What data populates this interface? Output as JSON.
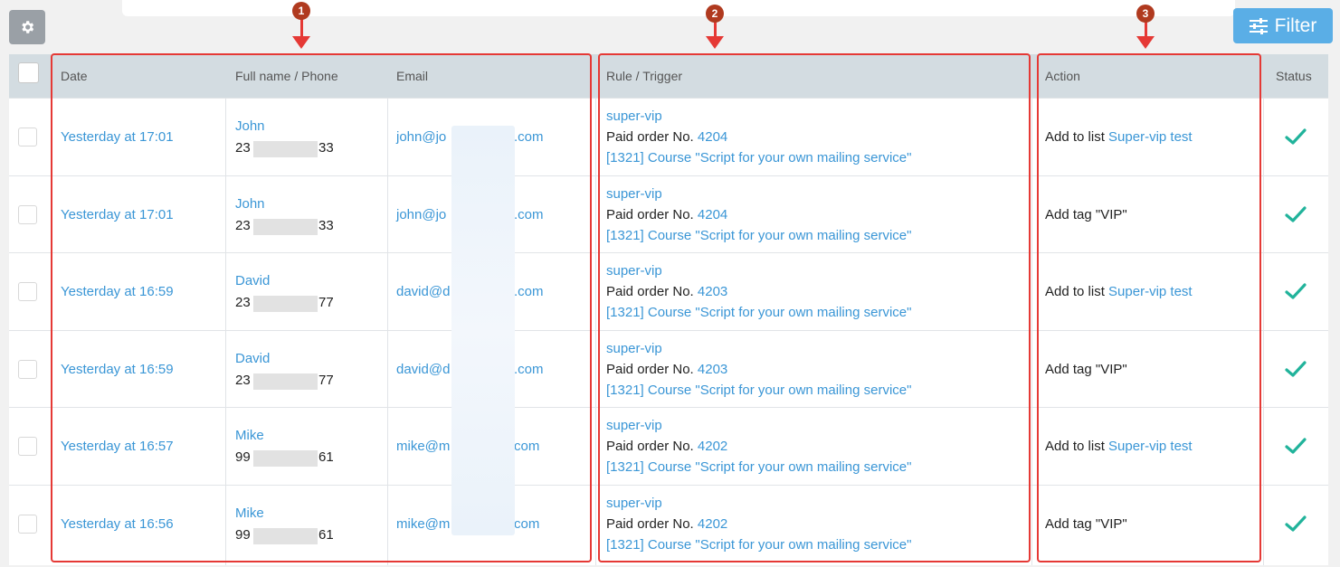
{
  "toolbar": {
    "filter_label": "Filter",
    "settings_icon": "gear-icon",
    "filter_icon": "sliders-icon"
  },
  "headers": {
    "date": "Date",
    "name_phone": "Full name / Phone",
    "email": "Email",
    "rule_trigger": "Rule / Trigger",
    "action": "Action",
    "status": "Status"
  },
  "markers": [
    "1",
    "2",
    "3"
  ],
  "rows": [
    {
      "date": "Yesterday at 17:01",
      "name": "John",
      "phone_start": "23",
      "phone_end": "33",
      "email_start": "john@jo",
      "email_end": ".com",
      "rule": "super-vip",
      "order_label": "Paid order No.",
      "order_no": "4204",
      "course": "[1321] Course \"Script for your own mailing service\"",
      "action_text": "Add to list",
      "action_link": "Super-vip test"
    },
    {
      "date": "Yesterday at 17:01",
      "name": "John",
      "phone_start": "23",
      "phone_end": "33",
      "email_start": "john@jo",
      "email_end": ".com",
      "rule": "super-vip",
      "order_label": "Paid order No.",
      "order_no": "4204",
      "course": "[1321] Course \"Script for your own mailing service\"",
      "action_text": "Add tag \"VIP\"",
      "action_link": ""
    },
    {
      "date": "Yesterday at 16:59",
      "name": "David",
      "phone_start": "23",
      "phone_end": "77",
      "email_start": "david@d",
      "email_end": ".com",
      "rule": "super-vip",
      "order_label": "Paid order No.",
      "order_no": "4203",
      "course": "[1321] Course \"Script for your own mailing service\"",
      "action_text": "Add to list",
      "action_link": "Super-vip test"
    },
    {
      "date": "Yesterday at 16:59",
      "name": "David",
      "phone_start": "23",
      "phone_end": "77",
      "email_start": "david@d",
      "email_end": ".com",
      "rule": "super-vip",
      "order_label": "Paid order No.",
      "order_no": "4203",
      "course": "[1321] Course \"Script for your own mailing service\"",
      "action_text": "Add tag \"VIP\"",
      "action_link": ""
    },
    {
      "date": "Yesterday at 16:57",
      "name": "Mike",
      "phone_start": "99",
      "phone_end": "61",
      "email_start": "mike@m",
      "email_end": "com",
      "rule": "super-vip",
      "order_label": "Paid order No.",
      "order_no": "4202",
      "course": "[1321] Course \"Script for your own mailing service\"",
      "action_text": "Add to list",
      "action_link": "Super-vip test"
    },
    {
      "date": "Yesterday at 16:56",
      "name": "Mike",
      "phone_start": "99",
      "phone_end": "61",
      "email_start": "mike@m",
      "email_end": "com",
      "rule": "super-vip",
      "order_label": "Paid order No.",
      "order_no": "4202",
      "course": "[1321] Course \"Script for your own mailing service\"",
      "action_text": "Add tag \"VIP\"",
      "action_link": ""
    }
  ],
  "colors": {
    "link": "#3a96d6",
    "check": "#21b39b",
    "highlight": "#e53935",
    "marker": "#b03a1f",
    "filter_bg": "#5aaee6"
  }
}
